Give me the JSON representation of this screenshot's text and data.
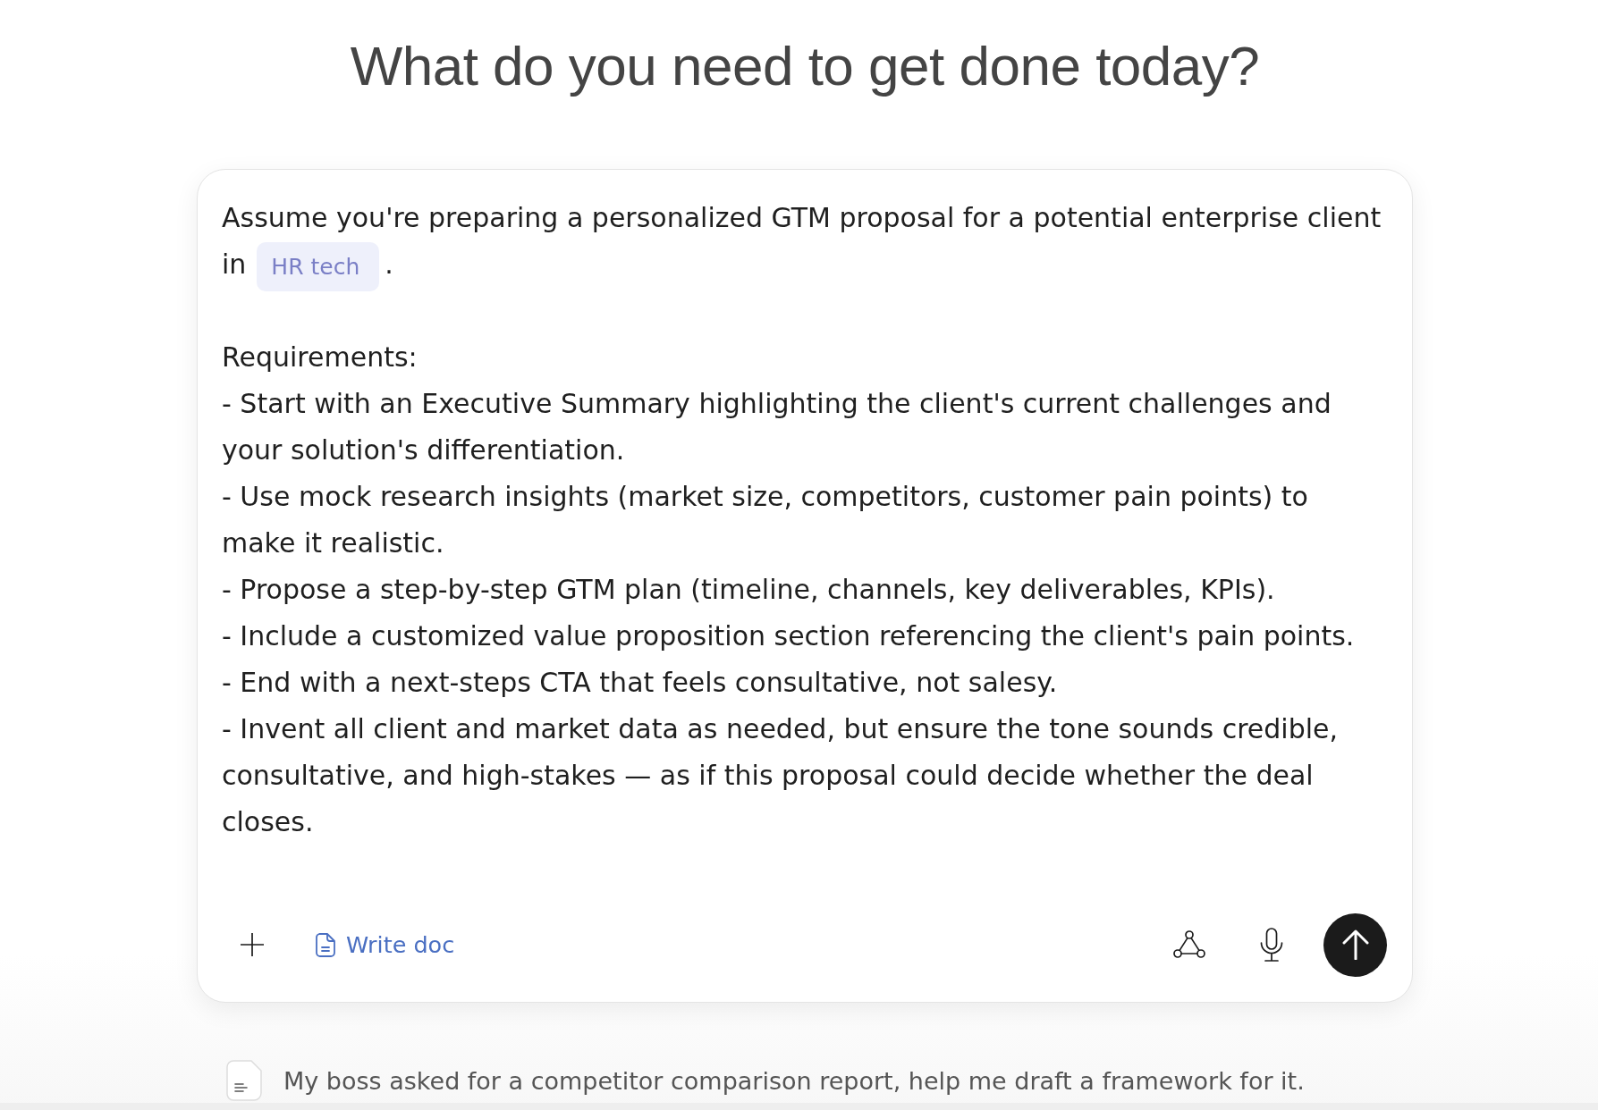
{
  "heading": "What do you need to get done today?",
  "prompt": {
    "intro_lines": [
      "Assume you're preparing a personalized GTM proposal for a potential enterprise client",
      "in"
    ],
    "variable": "HR tech",
    "intro_end": ".",
    "requirements_label": "Requirements:",
    "requirements": [
      "- Start with an Executive Summary highlighting the client's current challenges and your solution's differentiation.",
      "- Use mock research insights (market size, competitors, customer pain points) to make it realistic.",
      "- Propose a step-by-step GTM plan (timeline, channels, key deliverables, KPIs).",
      "- Include a customized value proposition section referencing the client's pain points.",
      "- End with a next-steps CTA that feels consultative, not salesy.",
      "- Invent all client and market data as needed, but ensure the tone sounds credible, consultative, and high-stakes — as if this proposal could decide whether the deal closes."
    ]
  },
  "toolbar": {
    "write_doc_label": "Write doc"
  },
  "suggestions": [
    {
      "text": "My boss asked for a competitor comparison report, help me draft a framework for it."
    }
  ]
}
